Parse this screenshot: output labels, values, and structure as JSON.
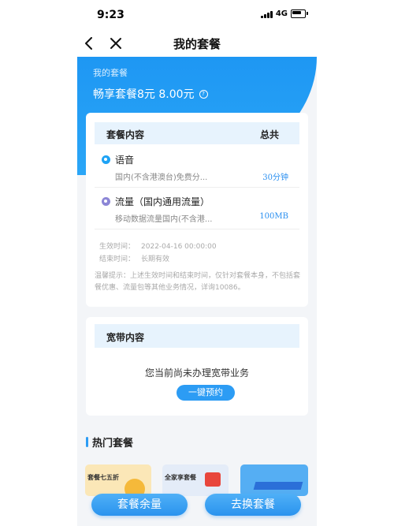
{
  "status_bar": {
    "time": "9:23",
    "network": "4G"
  },
  "nav": {
    "title": "我的套餐"
  },
  "hero": {
    "label": "我的套餐",
    "plan": "畅享套餐8元 8.00元",
    "help_glyph": "?"
  },
  "package": {
    "header_left": "套餐内容",
    "header_right": "总共",
    "items": [
      {
        "name": "语音",
        "desc": "国内(不含港澳台)免费分...",
        "value": "30分钟",
        "dot_color": "#1ea3f5"
      },
      {
        "name": "流量（国内通用流量）",
        "desc": "移动数据流量国内(不含港...",
        "value": "100MB",
        "dot_color": "#8c86d6"
      }
    ],
    "effective_label": "生效时间：",
    "effective_value": "2022-04-16 00:00:00",
    "end_label": "结束时间：",
    "end_value": "长期有效",
    "tip": "温馨提示：上述生效时间和结束时间，仅针对套餐本身，不包括套餐优惠、流量包等其他业务情况，详询10086。"
  },
  "broadband": {
    "header": "宽带内容",
    "message": "您当前尚未办理宽带业务",
    "button": "一键预约"
  },
  "hot": {
    "title": "热门套餐",
    "promos": [
      "套餐七五折",
      "全家享套餐",
      ""
    ]
  },
  "bottom": {
    "balance_button": "套餐余量",
    "change_button": "去换套餐"
  },
  "colors": {
    "accent": "#2c9cf4",
    "hero": "#1e97f3"
  }
}
